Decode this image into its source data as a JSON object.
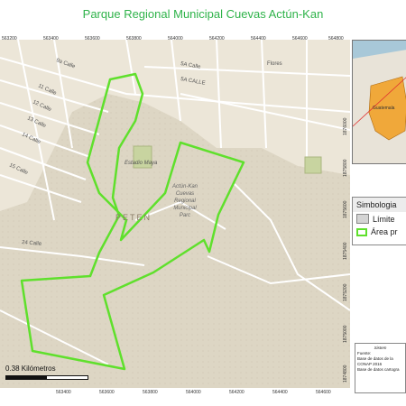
{
  "title": "Parque Regional Municipal Cuevas Actún-Kan",
  "map": {
    "x_ticks_top": [
      "563200",
      "563400",
      "563600",
      "563800",
      "564000",
      "564200",
      "564400",
      "564600",
      "564800",
      "565000"
    ],
    "x_ticks_bottom": [
      "563400",
      "563600",
      "563800",
      "564000",
      "564200",
      "564400",
      "564600",
      "564800"
    ],
    "y_ticks": [
      "1876000",
      "1875800",
      "1875600",
      "1875400",
      "1875200",
      "1875000",
      "1874800",
      "1874600",
      "1874400"
    ],
    "street_labels": [
      "9a Calle",
      "11 Calle",
      "12 Calle",
      "13 Calle",
      "14 Calle",
      "15 Calle",
      "24 Calle",
      "5A Calle",
      "5A CALLE",
      "Flores"
    ],
    "place_labels": {
      "stadium": "Estadio Maya",
      "region": "PETEN",
      "park_label": [
        "Actún-Kan",
        "Cuevas",
        "Regional",
        "Municipal",
        "Parc"
      ]
    },
    "colors": {
      "terrain": "#ddd6c4",
      "urban": "#ece6d8",
      "boundary": "#5fe02c",
      "roads": "#ffffff"
    }
  },
  "scale": {
    "label": "0.38 Kilómetros"
  },
  "inset": {
    "label": "Guatemala",
    "colors": {
      "sea": "#a8c8d8",
      "land": "#e8e3d8",
      "country": "#f0a83a",
      "pointer": "#e03030"
    }
  },
  "legend": {
    "title": "Simbologia",
    "items": [
      {
        "label": "Límite",
        "color": "#d4d4d4"
      },
      {
        "label": "Área pr",
        "color": "#5fe02c"
      }
    ]
  },
  "source": {
    "heading": "Sistem",
    "lines": [
      "Fuente:",
      "Base de datos de la",
      "CONAP 2016",
      "Base de datos cartogra"
    ]
  }
}
